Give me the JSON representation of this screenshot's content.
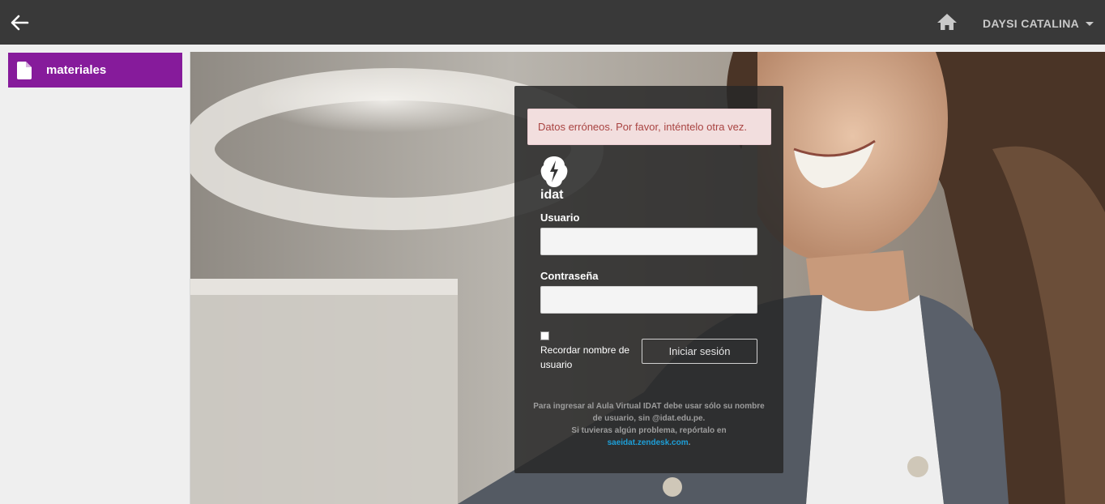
{
  "topbar": {
    "back_icon": "arrow-left-icon",
    "home_icon": "home-icon",
    "user_name": "DAYSI CATALINA",
    "caret_icon": "caret-down-icon"
  },
  "sidebar": {
    "items": [
      {
        "label": "materiales",
        "icon": "file-icon"
      }
    ]
  },
  "login": {
    "alert": "Datos erróneos. Por favor, inténtelo otra vez.",
    "logo_text": "idat",
    "username_label": "Usuario",
    "username_value": "",
    "password_label": "Contraseña",
    "password_value": "",
    "remember_label": "Recordar nombre de usuario",
    "remember_checked": false,
    "submit_label": "Iniciar sesión",
    "help_line1": "Para ingresar al Aula Virtual IDAT debe usar sólo su nombre de usuario, sin @idat.edu.pe.",
    "help_line2": "Si tuvieras algún problema, repórtalo en",
    "help_link": "saeidat.zendesk.com",
    "help_suffix": "."
  },
  "colors": {
    "topbar": "#393939",
    "sidebar_active": "#861b9b",
    "alert_bg": "#f2dede",
    "alert_text": "#a94442",
    "link": "#1d9fd8"
  }
}
